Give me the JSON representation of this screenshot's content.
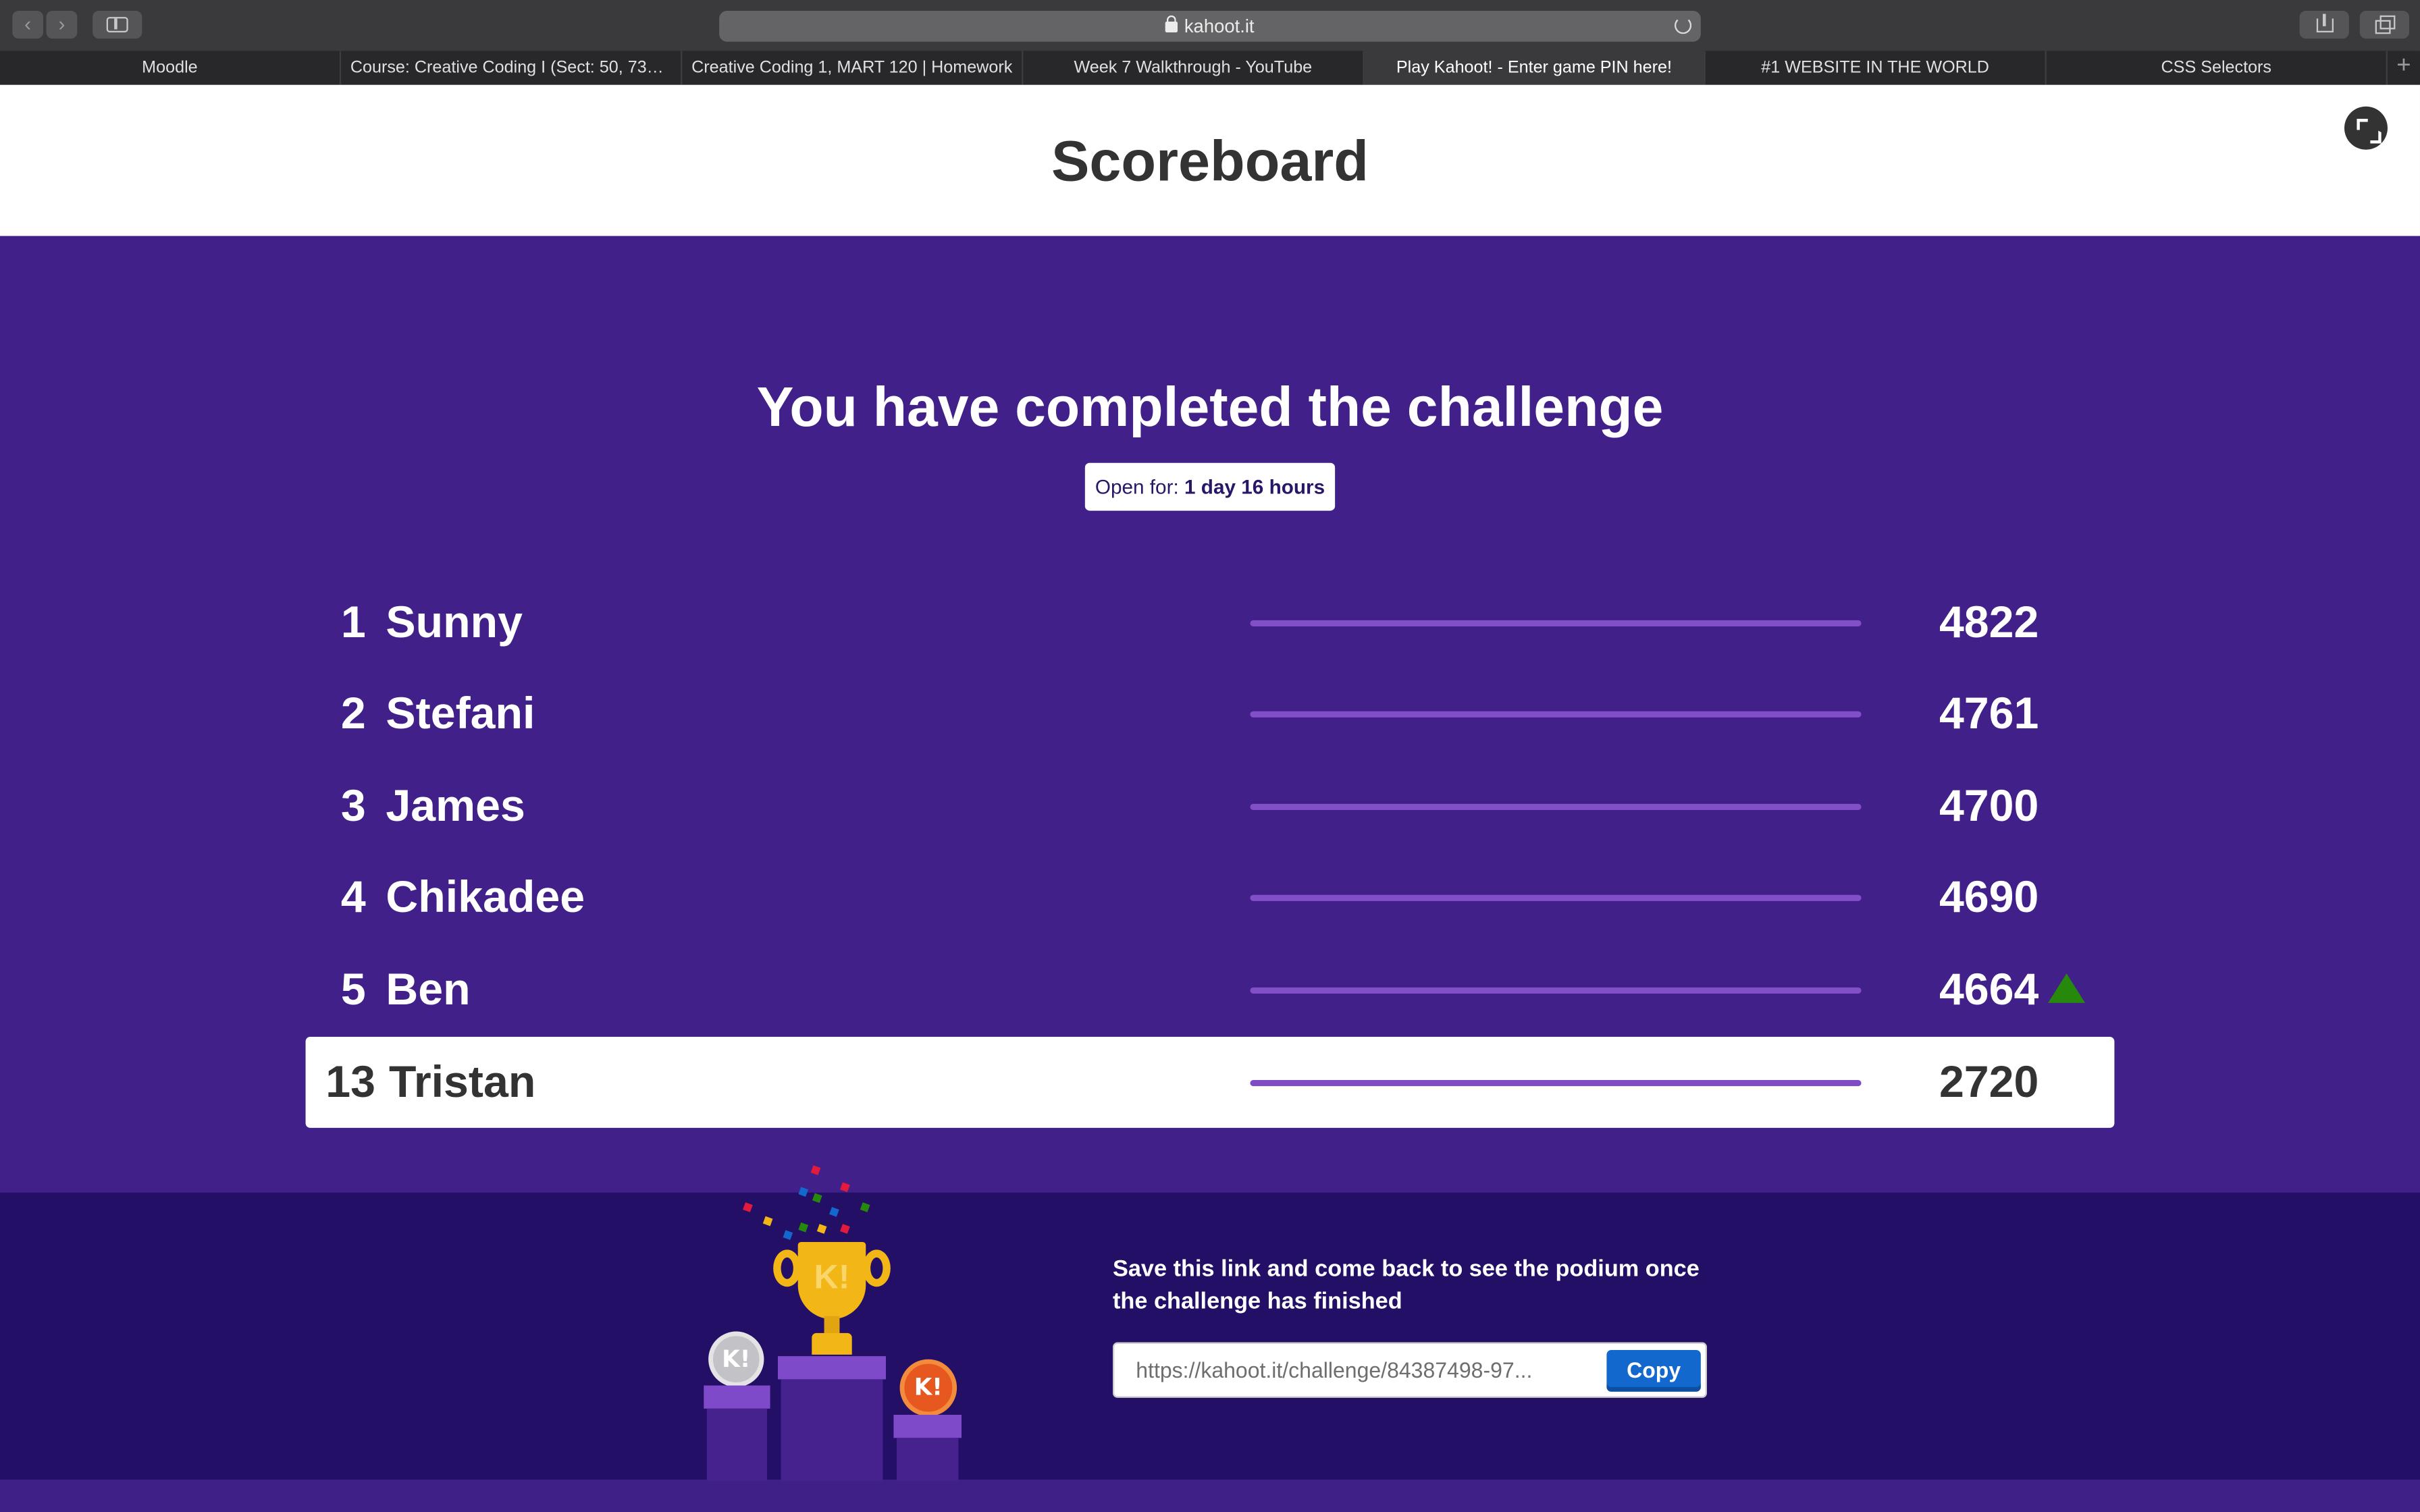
{
  "browser": {
    "url": "kahoot.it",
    "tabs": [
      {
        "label": "Moodle"
      },
      {
        "label": "Course: Creative Coding I (Sect: 50, 7315..."
      },
      {
        "label": "Creative Coding 1, MART 120 | Homework"
      },
      {
        "label": "Week 7 Walkthrough - YouTube"
      },
      {
        "label": "Play Kahoot! - Enter game PIN here!"
      },
      {
        "label": "#1 WEBSITE IN THE WORLD"
      },
      {
        "label": "CSS Selectors"
      }
    ],
    "active_tab": 4,
    "back_glyph": "‹",
    "forward_glyph": "›",
    "add_tab_glyph": "+"
  },
  "page": {
    "title": "Scoreboard",
    "headline": "You have completed the challenge",
    "open_for_label": "Open for:",
    "open_for_value": "1 day 16 hours"
  },
  "leaderboard": [
    {
      "rank": "1",
      "name": "Sunny",
      "score": "4822"
    },
    {
      "rank": "2",
      "name": "Stefani",
      "score": "4761"
    },
    {
      "rank": "3",
      "name": "James",
      "score": "4700"
    },
    {
      "rank": "4",
      "name": "Chikadee",
      "score": "4690"
    },
    {
      "rank": "5",
      "name": "Ben",
      "score": "4664",
      "trend": "up"
    },
    {
      "rank": "13",
      "name": "Tristan",
      "score": "2720",
      "is_current_player": true
    }
  ],
  "footer": {
    "save_text": "Save this link and come back to see the podium once the challenge has finished",
    "link": "https://kahoot.it/challenge/84387498-97...",
    "copy_label": "Copy",
    "trophy_logo": "K!",
    "silver_medal_logo": "K!",
    "bronze_medal_logo": "K!"
  },
  "colors": {
    "main_purple": "#41208a",
    "footer_purple": "#240f66",
    "bar_purple": "#8150c8",
    "trend_up_green": "#26890c",
    "copy_blue": "#1368ce",
    "trophy_gold": "#f3b617"
  }
}
